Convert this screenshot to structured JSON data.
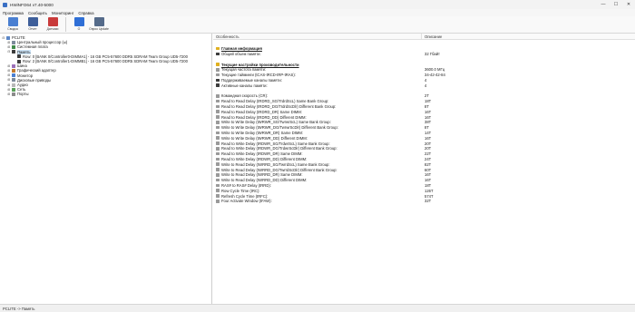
{
  "window": {
    "title": "HWiNFO64 v7.40-5000",
    "controls": [
      "—",
      "☐",
      "✕"
    ]
  },
  "menu": [
    "Программа",
    "Сообщить",
    "Мониторинг",
    "Справка"
  ],
  "toolbar": [
    {
      "label": "Сводка",
      "icon": "monitor-icon",
      "color": "#4a7fd1"
    },
    {
      "label": "Отчет",
      "icon": "save-icon",
      "color": "#3f5f9a"
    },
    {
      "label": "Датчики",
      "icon": "sensors-icon",
      "color": "#c93b3b"
    },
    {
      "label": "О",
      "icon": "info-icon",
      "color": "#2f6fd6"
    },
    {
      "label": "Опрос Update",
      "icon": "update-icon",
      "color": "#556b8a"
    }
  ],
  "tree": [
    {
      "label": "PCLITE",
      "level": 0,
      "exp": "⊟",
      "icon_color": "#5b86c7"
    },
    {
      "label": "Центральный процессор (ы)",
      "level": 1,
      "exp": "⊞",
      "icon_color": "#7c8a9b"
    },
    {
      "label": "Системная плата",
      "level": 1,
      "exp": "⊞",
      "icon_color": "#3f8a4a"
    },
    {
      "label": "Память",
      "level": 1,
      "exp": "⊟",
      "icon_color": "#3c3c3c",
      "selected": true
    },
    {
      "label": "Row: 0 [BANK 0/Controller0-DIMMA1] - 16 GB PC5-57600 DDR5 SDRAM Team Group UD5-7200",
      "level": 2,
      "exp": "",
      "icon_color": "#3c3c3c"
    },
    {
      "label": "Row: 2 [BANK 0/Controller1-DIMMB1] - 16 GB PC5-57600 DDR5 SDRAM Team Group UD5-7200",
      "level": 2,
      "exp": "",
      "icon_color": "#3c3c3c"
    },
    {
      "label": "Шина",
      "level": 1,
      "exp": "⊞",
      "icon_color": "#9b6fb8"
    },
    {
      "label": "Графический адаптер",
      "level": 1,
      "exp": "⊞",
      "icon_color": "#c27a2e"
    },
    {
      "label": "Монитор",
      "level": 1,
      "exp": "⊞",
      "icon_color": "#4a7fd1"
    },
    {
      "label": "Дисковые приводы",
      "level": 1,
      "exp": "⊞",
      "icon_color": "#7c8a9b"
    },
    {
      "label": "Аудио",
      "level": 1,
      "exp": "⊞",
      "icon_color": "#b8b8b8"
    },
    {
      "label": "Сеть",
      "level": 1,
      "exp": "⊞",
      "icon_color": "#5aa05a"
    },
    {
      "label": "Порты",
      "level": 1,
      "exp": "⊞",
      "icon_color": "#8a8a8a"
    }
  ],
  "grid": {
    "col_feature": "Особенность",
    "col_value": "Описание",
    "rows": [
      {
        "feature": "",
        "value": "",
        "type": "blank"
      },
      {
        "feature": "Главная информация",
        "value": "",
        "type": "section",
        "icon_color": "#e0b020"
      },
      {
        "feature": "Общий объем памяти:",
        "value": "32 Гбайт",
        "type": "item",
        "icon_color": "#3c3c3c"
      },
      {
        "feature": "",
        "value": "",
        "type": "blank"
      },
      {
        "feature": "Текущие настройки производительности",
        "value": "",
        "type": "section",
        "icon_color": "#e0b020"
      },
      {
        "feature": "Текущая частота памяти:",
        "value": "3600.0 МГц",
        "type": "item",
        "icon_color": "#9a9a9a"
      },
      {
        "feature": "Текущие тайминги (tCAS-tRCD-tRP-tRAS):",
        "value": "34-42-42-84",
        "type": "item",
        "icon_color": "#9a9a9a"
      },
      {
        "feature": "Поддерживаемые каналы памяти:",
        "value": "4",
        "type": "item",
        "icon_color": "#3c3c3c"
      },
      {
        "feature": "Активные каналы памяти:",
        "value": "4",
        "type": "item",
        "icon_color": "#3c3c3c"
      },
      {
        "feature": "",
        "value": "",
        "type": "blank"
      },
      {
        "feature": "Командная скорость (CR):",
        "value": "2T",
        "type": "item",
        "icon_color": "#9a9a9a"
      },
      {
        "feature": "Read to Read Delay (tRDRD_SG/TrdrdScL) Same Bank Group:",
        "value": "18T",
        "type": "item",
        "icon_color": "#9a9a9a"
      },
      {
        "feature": "Read to Read Delay (tRDRD_DG/TrdrdScDlr) Different Bank Group:",
        "value": "8T",
        "type": "item",
        "icon_color": "#9a9a9a"
      },
      {
        "feature": "Read to Read Delay (tRDRD_DR) Same DIMM:",
        "value": "16T",
        "type": "item",
        "icon_color": "#9a9a9a"
      },
      {
        "feature": "Read to Read Delay (tRDRD_DD) Different DIMM:",
        "value": "16T",
        "type": "item",
        "icon_color": "#9a9a9a"
      },
      {
        "feature": "Write to Write Delay (tWRWR_SG/TwrwrScL) Same Bank Group:",
        "value": "38T",
        "type": "item",
        "icon_color": "#9a9a9a"
      },
      {
        "feature": "Write to Write Delay (tWRWR_DG/TwrwrScDlr) Different Bank Group:",
        "value": "8T",
        "type": "item",
        "icon_color": "#9a9a9a"
      },
      {
        "feature": "Write to Write Delay (tWRWR_DR) Same DIMM:",
        "value": "14T",
        "type": "item",
        "icon_color": "#9a9a9a"
      },
      {
        "feature": "Write to Write Delay (tWRWR_DD) Different DIMM:",
        "value": "16T",
        "type": "item",
        "icon_color": "#9a9a9a"
      },
      {
        "feature": "Read to Write Delay (tRDWR_SG/TrdwrScL) Same Bank Group:",
        "value": "20T",
        "type": "item",
        "icon_color": "#9a9a9a"
      },
      {
        "feature": "Read to Write Delay (tRDWR_DG/TrdwrScDlr) Different Bank Group:",
        "value": "20T",
        "type": "item",
        "icon_color": "#9a9a9a"
      },
      {
        "feature": "Read to Write Delay (tRDWR_DR) Same DIMM:",
        "value": "22T",
        "type": "item",
        "icon_color": "#9a9a9a"
      },
      {
        "feature": "Read to Write Delay (tRDWR_DD) Different DIMM:",
        "value": "24T",
        "type": "item",
        "icon_color": "#9a9a9a"
      },
      {
        "feature": "Write to Read Delay (tWRRD_SG/TwrrdScL) Same Bank Group:",
        "value": "82T",
        "type": "item",
        "icon_color": "#9a9a9a"
      },
      {
        "feature": "Write to Read Delay (tWRRD_DG/TwrrdScDlr) Different Bank Group:",
        "value": "60T",
        "type": "item",
        "icon_color": "#9a9a9a"
      },
      {
        "feature": "Write to Read Delay (tWRRD_DR) Same DIMM:",
        "value": "16T",
        "type": "item",
        "icon_color": "#9a9a9a"
      },
      {
        "feature": "Write to Read Delay (tWRRD_DD) Different DIMM:",
        "value": "16T",
        "type": "item",
        "icon_color": "#9a9a9a"
      },
      {
        "feature": "RAS# to RAS# Delay (tRRD):",
        "value": "18T",
        "type": "item",
        "icon_color": "#9a9a9a"
      },
      {
        "feature": "Row Cycle Time (tRC):",
        "value": "126T",
        "type": "item",
        "icon_color": "#9a9a9a"
      },
      {
        "feature": "Refresh Cycle Time (tRFC):",
        "value": "574T",
        "type": "item",
        "icon_color": "#9a9a9a"
      },
      {
        "feature": "Four Activate Window (tFAW):",
        "value": "32T",
        "type": "item",
        "icon_color": "#9a9a9a"
      }
    ]
  },
  "status": "PCLITE -> Память"
}
